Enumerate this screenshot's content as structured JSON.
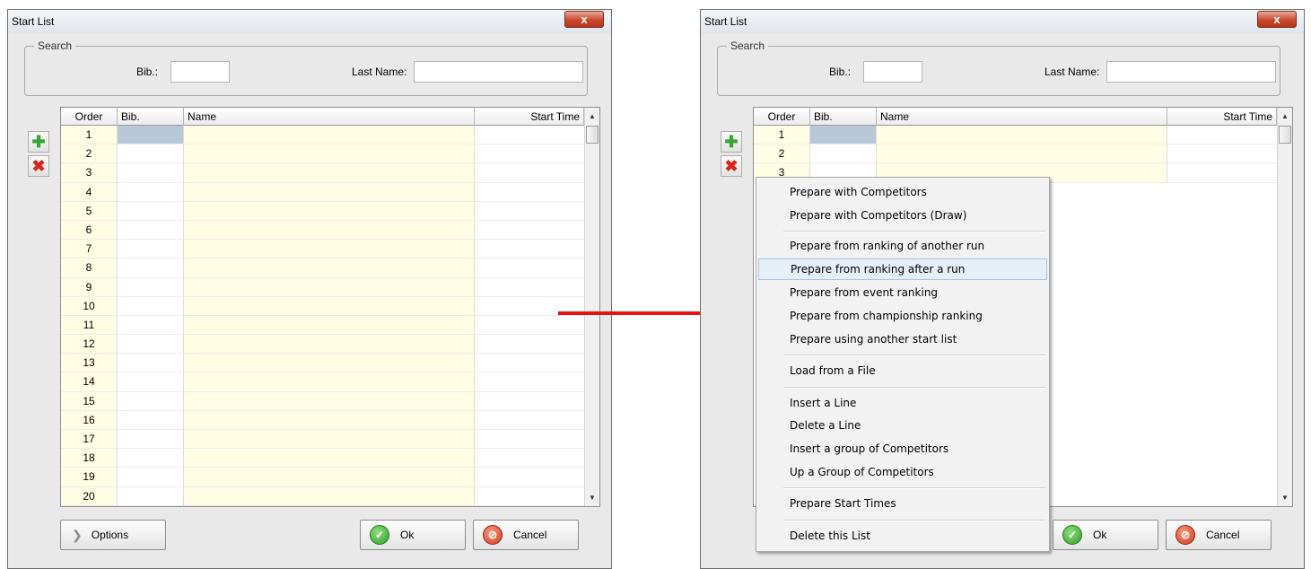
{
  "colors": {
    "arrow": "#ff0000",
    "hover_bg": "#e6eef8",
    "cell_tint": "#fffde3",
    "selected_cell": "#b8c8d8"
  },
  "window": {
    "title": "Start List",
    "close_label": "x"
  },
  "search": {
    "legend": "Search",
    "bib_label": "Bib.:",
    "last_name_label": "Last Name:",
    "bib_value": "",
    "last_name_value": ""
  },
  "side_buttons": {
    "add_icon": "plus-icon",
    "delete_icon": "delete-x-icon"
  },
  "grid": {
    "columns": [
      "Order",
      "Bib.",
      "Name",
      "Start Time"
    ],
    "rows_left": [
      "1",
      "2",
      "3",
      "4",
      "5",
      "6",
      "7",
      "8",
      "9",
      "10",
      "11",
      "12",
      "13",
      "14",
      "15",
      "16",
      "17",
      "18",
      "19",
      "20"
    ],
    "rows_right": [
      "1",
      "2",
      "3"
    ]
  },
  "buttons": {
    "options": "Options",
    "ok": "Ok",
    "cancel": "Cancel"
  },
  "context_menu": {
    "items": [
      "Prepare with Competitors",
      "Prepare with Competitors (Draw)",
      "Prepare from ranking of another run",
      "Prepare from ranking after a run",
      "Prepare from event ranking",
      "Prepare from championship ranking",
      "Prepare using another start list",
      "Load from a File",
      "Insert a Line",
      "Delete a Line",
      "Insert a group of Competitors",
      "Up a Group of Competitors",
      "Prepare Start Times",
      "Delete this List"
    ],
    "hovered": "Prepare from ranking after a run"
  }
}
